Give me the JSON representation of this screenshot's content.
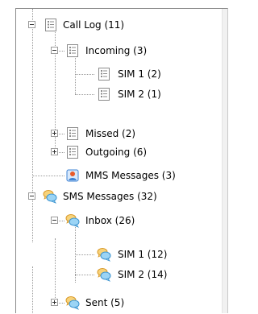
{
  "tree": {
    "call_log": "Call Log (11)",
    "incoming": "Incoming (3)",
    "incoming_sim1": "SIM 1 (2)",
    "incoming_sim2": "SIM 2 (1)",
    "missed": "Missed (2)",
    "outgoing": "Outgoing (6)",
    "mms": "MMS Messages (3)",
    "sms": "SMS Messages (32)",
    "inbox": "Inbox (26)",
    "inbox_sim1": "SIM 1 (12)",
    "inbox_sim2": "SIM 2 (14)",
    "sent": "Sent (5)"
  },
  "icons": {
    "log": "document-list-icon",
    "mms": "contact-card-icon",
    "sms": "speech-bubble-icon"
  },
  "colors": {
    "log_icon": "#7a7a7a",
    "bubble_back": "#f2b23f",
    "bubble_front": "#5cb6ea",
    "mms_card": "#3f84d6"
  }
}
